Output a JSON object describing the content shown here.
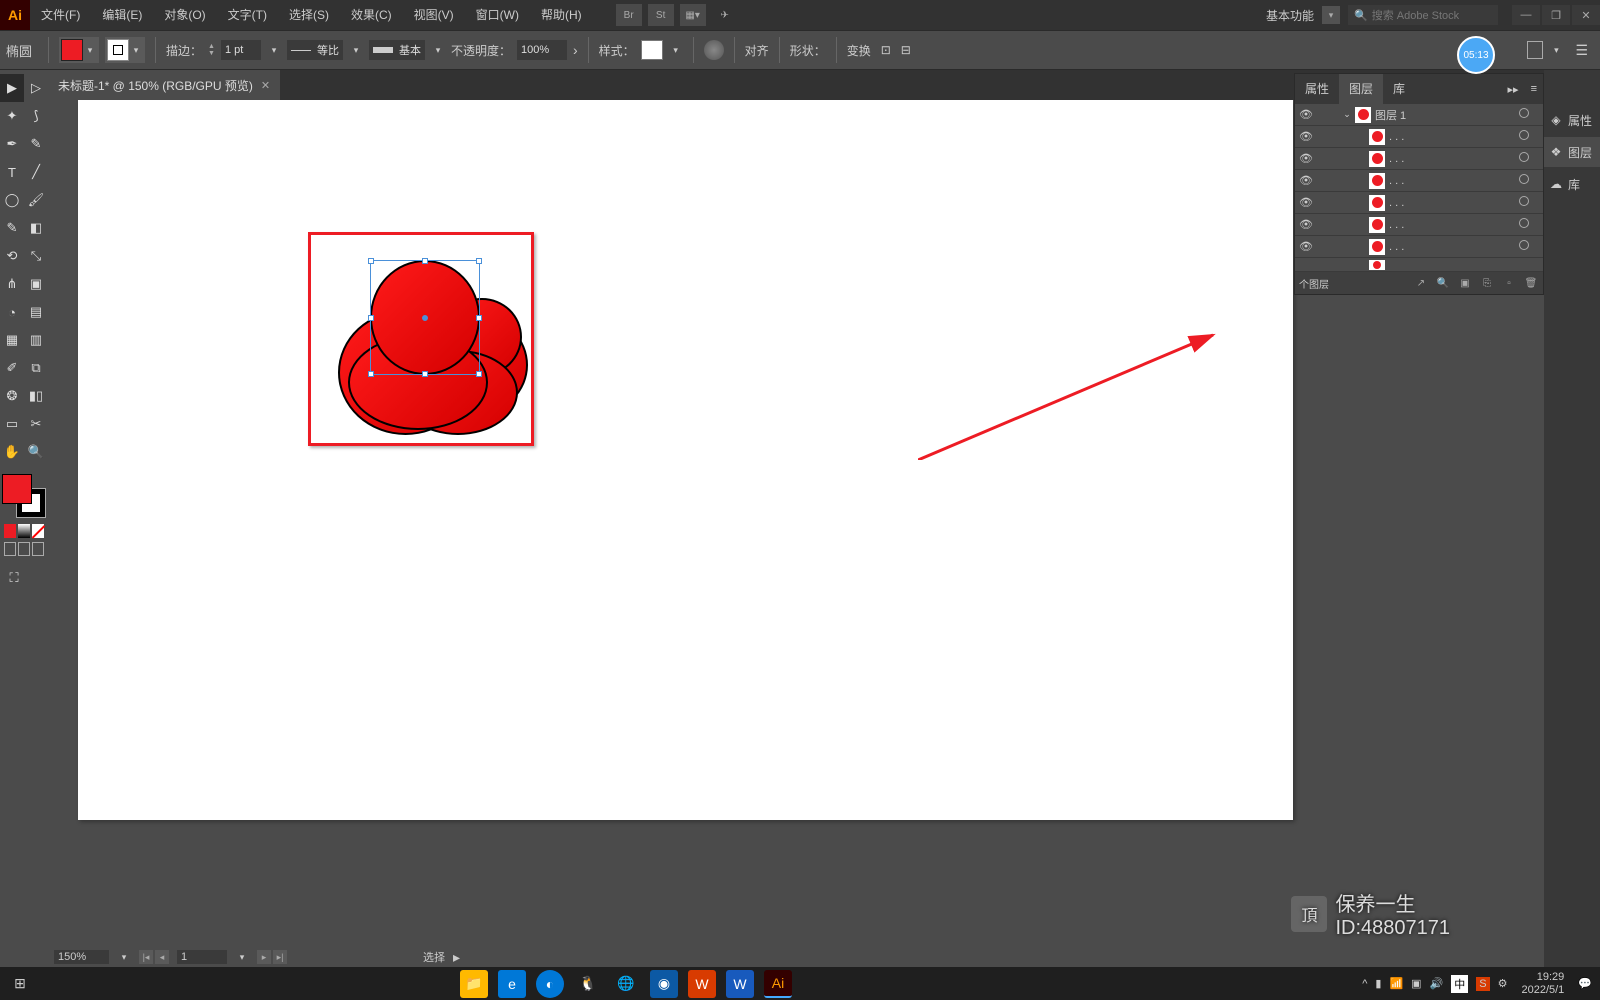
{
  "app": {
    "logo": "Ai"
  },
  "menubar": {
    "items": [
      "文件(F)",
      "编辑(E)",
      "对象(O)",
      "文字(T)",
      "选择(S)",
      "效果(C)",
      "视图(V)",
      "窗口(W)",
      "帮助(H)"
    ],
    "ext_btns": [
      "Br",
      "St"
    ],
    "workspace": "基本功能",
    "search_placeholder": "搜索 Adobe Stock"
  },
  "ctrlbar": {
    "tool": "椭圆",
    "stroke_label": "描边：",
    "stroke_weight": "1 pt",
    "dash_label": "等比",
    "profile_label": "基本",
    "opacity_label": "不透明度：",
    "opacity_value": "100%",
    "style_label": "样式：",
    "align_label": "对齐",
    "shape_label": "形状：",
    "transform_label": "变换",
    "timer": "05:13"
  },
  "doc": {
    "tab_title": "未标题-1* @ 150% (RGB/GPU 预览)"
  },
  "panel": {
    "tabs": [
      "属性",
      "图层",
      "库"
    ],
    "layer_name": "图层 1",
    "sub_label": ". . .",
    "footer_label": "个图层"
  },
  "rail": {
    "items": [
      "属性",
      "图层",
      "库"
    ]
  },
  "status": {
    "zoom": "150%",
    "page": "1",
    "mode": "选择"
  },
  "taskbar": {
    "ime": "中",
    "time": "19:29",
    "date": "2022/5/1"
  },
  "watermark": {
    "line1": "保养一生",
    "line2": "ID:48807171"
  }
}
